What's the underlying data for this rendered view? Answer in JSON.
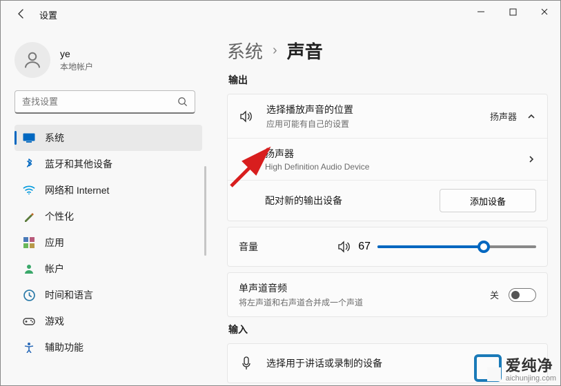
{
  "window": {
    "title": "设置"
  },
  "profile": {
    "name": "ye",
    "account_type": "本地帐户"
  },
  "search": {
    "placeholder": "查找设置"
  },
  "nav": {
    "items": [
      {
        "label": "系统",
        "icon": "system"
      },
      {
        "label": "蓝牙和其他设备",
        "icon": "bluetooth"
      },
      {
        "label": "网络和 Internet",
        "icon": "wifi"
      },
      {
        "label": "个性化",
        "icon": "personalize"
      },
      {
        "label": "应用",
        "icon": "apps"
      },
      {
        "label": "帐户",
        "icon": "accounts"
      },
      {
        "label": "时间和语言",
        "icon": "time"
      },
      {
        "label": "游戏",
        "icon": "gaming"
      },
      {
        "label": "辅助功能",
        "icon": "accessibility"
      }
    ],
    "selected_index": 0
  },
  "breadcrumb": {
    "root": "系统",
    "current": "声音"
  },
  "sections": {
    "output_header": "输出",
    "input_header": "输入",
    "choose_output": {
      "title": "选择播放声音的位置",
      "subtitle": "应用可能有自己的设置",
      "value": "扬声器"
    },
    "speaker": {
      "title": "扬声器",
      "subtitle": "High Definition Audio Device"
    },
    "pair_new": {
      "title": "配对新的输出设备",
      "button": "添加设备"
    },
    "volume": {
      "title": "音量",
      "value": 67
    },
    "mono": {
      "title": "单声道音频",
      "subtitle": "将左声道和右声道合并成一个声道",
      "state_label": "关",
      "on": false
    },
    "choose_input": {
      "title": "选择用于讲话或录制的设备"
    }
  },
  "watermark": {
    "brand": "爱纯净",
    "domain": "aichunjing.com"
  }
}
